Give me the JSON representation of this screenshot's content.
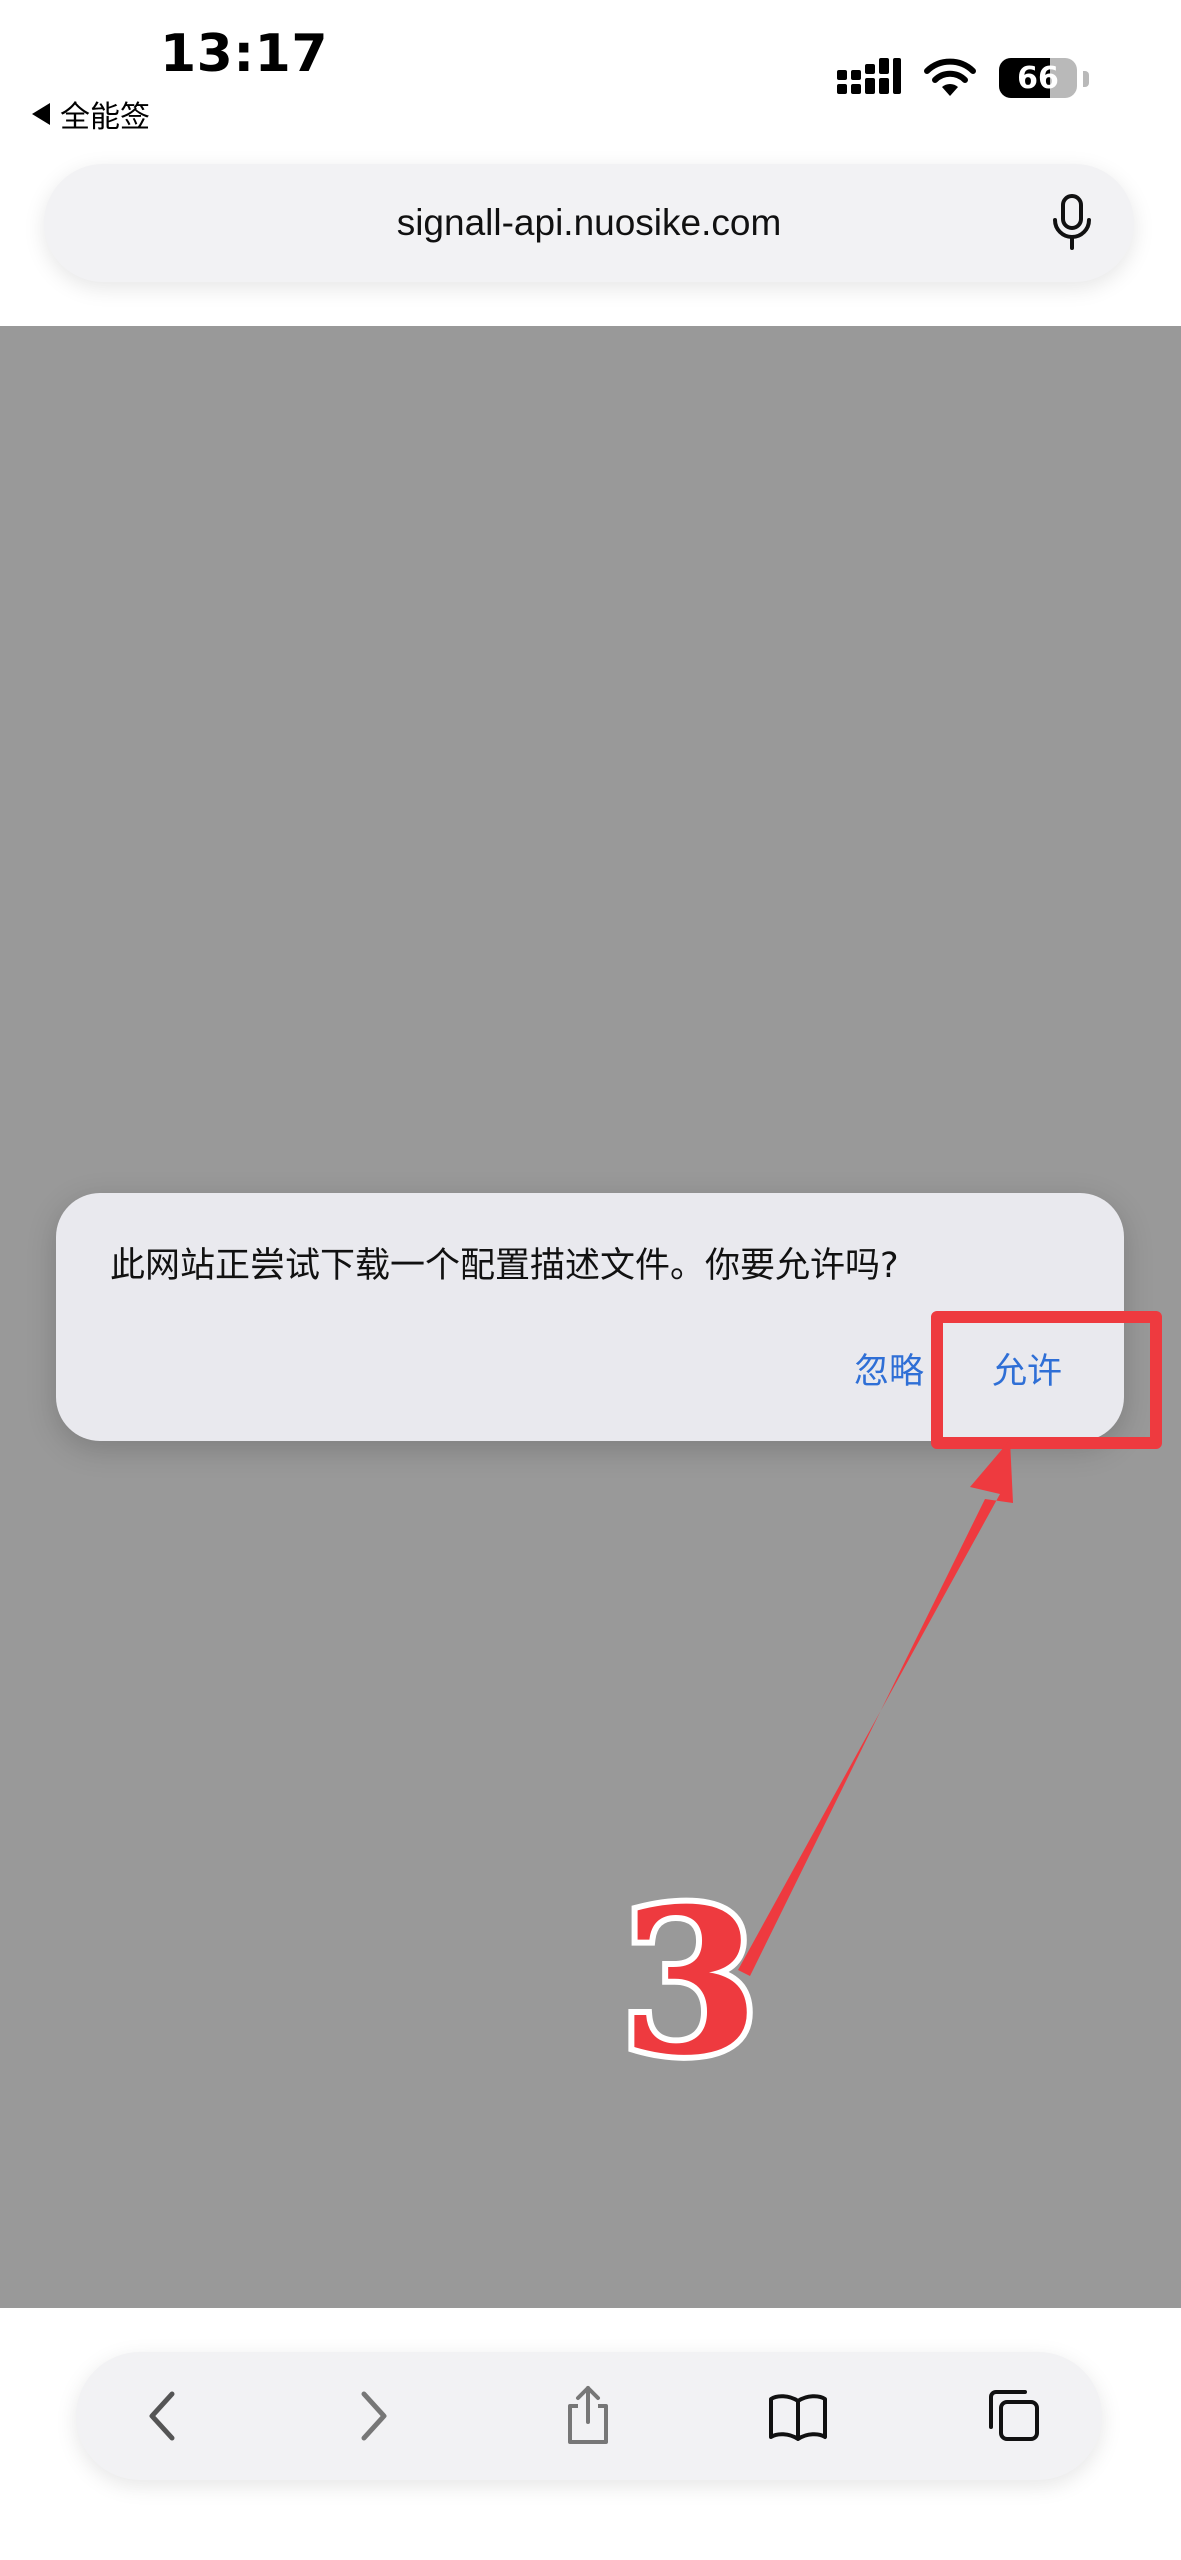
{
  "status_bar": {
    "time": "13:17",
    "back_app_label": "全能签",
    "battery_level": "66",
    "battery_fraction": 0.66
  },
  "address_bar": {
    "url": "signall-api.nuosike.com",
    "mic_icon": "microphone-icon"
  },
  "alert": {
    "message": "此网站正尝试下载一个配置描述文件。你要允许吗?",
    "ignore_label": "忽略",
    "allow_label": "允许"
  },
  "annotation": {
    "step_number": "3",
    "color": "#ee3a3f"
  },
  "toolbar": {
    "icons": [
      "back-icon",
      "forward-icon",
      "share-icon",
      "bookmarks-icon",
      "tabs-icon"
    ]
  },
  "colors": {
    "link_blue": "#2f6fd6",
    "overlay_gray": "#999999",
    "bar_background": "#f2f2f4"
  }
}
